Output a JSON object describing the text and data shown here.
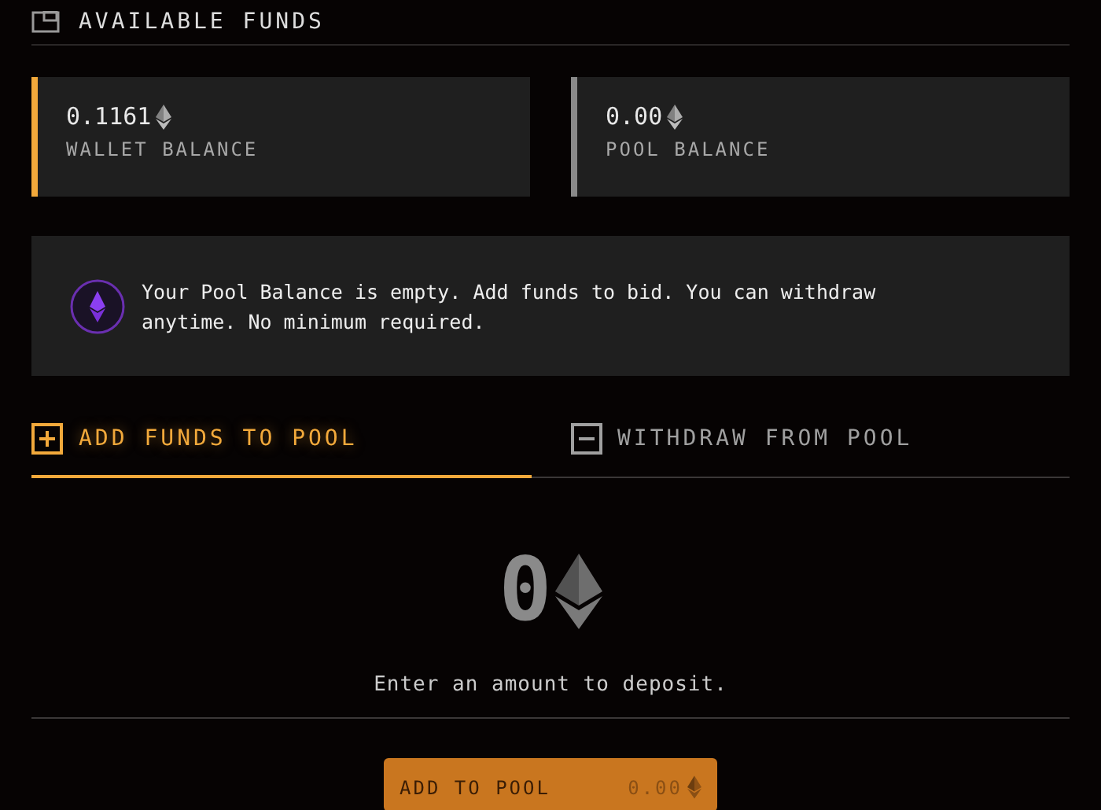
{
  "section": {
    "title": "AVAILABLE FUNDS"
  },
  "balances": [
    {
      "amount": "0.1161",
      "label": "WALLET BALANCE",
      "color": "#f2a93b"
    },
    {
      "amount": "0.00",
      "label": "POOL BALANCE",
      "color": "#8a8a8a"
    }
  ],
  "notice": {
    "text": "Your Pool Balance is empty. Add funds to bid. You can withdraw anytime. No minimum required."
  },
  "tabs": [
    {
      "label": "ADD FUNDS TO POOL",
      "kind": "add",
      "selected": true
    },
    {
      "label": "WITHDRAW FROM POOL",
      "kind": "withdraw",
      "selected": false
    }
  ],
  "deposit": {
    "amount": "0",
    "hint": "Enter an amount to deposit."
  },
  "button": {
    "label": "ADD TO POOL",
    "value": "0.00"
  }
}
